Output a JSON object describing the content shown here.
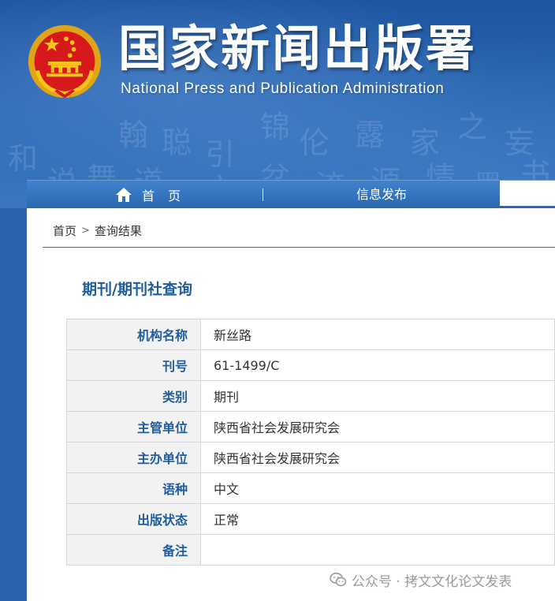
{
  "header": {
    "title": "国家新闻出版署",
    "subtitle": "National  Press and Publication Administration",
    "background_glyphs": [
      "翰",
      "聪",
      "引",
      "锦",
      "伦",
      "露",
      "家",
      "之",
      "妄",
      "和",
      "说",
      "舞",
      "道",
      "文",
      "盆",
      "流",
      "源",
      "情",
      "墨",
      "书"
    ]
  },
  "nav": {
    "home_label": "首 页",
    "news_label": "信息发布"
  },
  "breadcrumb": {
    "home": "首页",
    "separator": ">",
    "current": "查询结果"
  },
  "section": {
    "title": "期刊/期刊社查询"
  },
  "table": {
    "rows": [
      {
        "label": "机构名称",
        "value": "新丝路"
      },
      {
        "label": "刊号",
        "value": "61-1499/C"
      },
      {
        "label": "类别",
        "value": "期刊"
      },
      {
        "label": "主管单位",
        "value": "陕西省社会发展研究会"
      },
      {
        "label": "主办单位",
        "value": "陕西省社会发展研究会"
      },
      {
        "label": "语种",
        "value": "中文"
      },
      {
        "label": "出版状态",
        "value": "正常"
      },
      {
        "label": "备注",
        "value": ""
      }
    ]
  },
  "watermark": {
    "text": "公众号 · 拷文文化论文发表",
    "icon": "wechat-icon"
  },
  "colors": {
    "banner_blue": "#2a62ad",
    "label_blue": "#1f5d9e",
    "label_bg": "#f2f2f2",
    "emblem_red": "#d7191c",
    "emblem_gold": "#f5c518"
  }
}
